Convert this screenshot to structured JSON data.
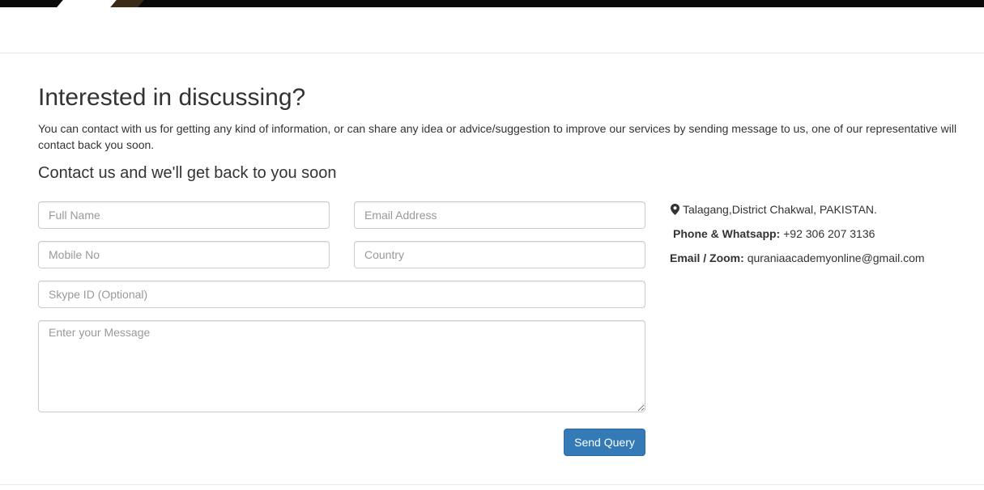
{
  "page": {
    "heading": "Interested in discussing?",
    "intro": "You can contact with us for getting any kind of information, or can share any idea or advice/suggestion to improve our services by sending message to us, one of our representative will contact back you soon.",
    "subheading": "Contact us and we'll get back to you soon"
  },
  "form": {
    "full_name": {
      "placeholder": "Full Name",
      "value": ""
    },
    "email": {
      "placeholder": "Email Address",
      "value": ""
    },
    "mobile": {
      "placeholder": "Mobile No",
      "value": ""
    },
    "country": {
      "placeholder": "Country",
      "value": ""
    },
    "skype": {
      "placeholder": "Skype ID (Optional)",
      "value": ""
    },
    "message": {
      "placeholder": "Enter your Message",
      "value": ""
    },
    "submit_label": "Send Query"
  },
  "contact_info": {
    "address": "Talagang,District Chakwal, PAKISTAN.",
    "phone_label": "Phone & Whatsapp:",
    "phone_value": "+92 306 207 3136",
    "email_label": "Email / Zoom:",
    "email_value": "quraniaacademyonline@gmail.com"
  },
  "icons": {
    "address_icon": "map-marker-icon"
  },
  "colors": {
    "primary_button": "#337ab7",
    "top_bar": "#0a0a0a",
    "text": "#333333",
    "input_border": "#cccccc"
  }
}
